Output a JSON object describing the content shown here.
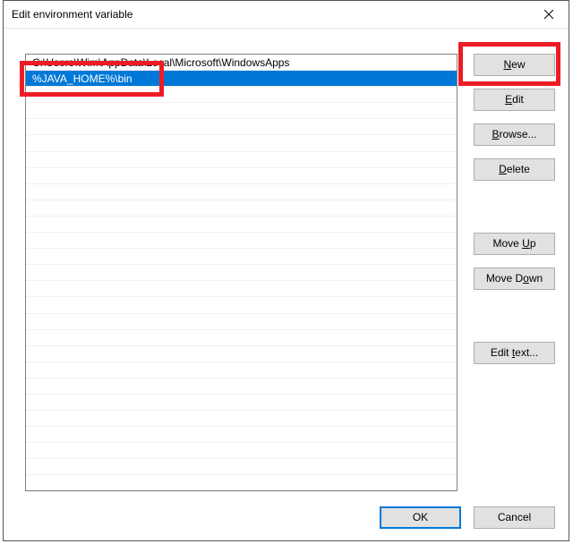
{
  "title": "Edit environment variable",
  "list": {
    "rows": [
      "C:\\Users\\Wim\\AppData\\Local\\Microsoft\\WindowsApps",
      "%JAVA_HOME%\\bin"
    ],
    "selected_index": 1,
    "blank_rows": 25
  },
  "buttons": {
    "new_pre": "",
    "new_accel": "N",
    "new_post": "ew",
    "edit_pre": "",
    "edit_accel": "E",
    "edit_post": "dit",
    "browse_pre": "",
    "browse_accel": "B",
    "browse_post": "rowse...",
    "delete_pre": "",
    "delete_accel": "D",
    "delete_post": "elete",
    "moveup_pre": "Move ",
    "moveup_accel": "U",
    "moveup_post": "p",
    "movedown_pre": "Move D",
    "movedown_accel": "o",
    "movedown_post": "wn",
    "edittext_pre": "Edit ",
    "edittext_accel": "t",
    "edittext_post": "ext...",
    "ok": "OK",
    "cancel": "Cancel"
  }
}
